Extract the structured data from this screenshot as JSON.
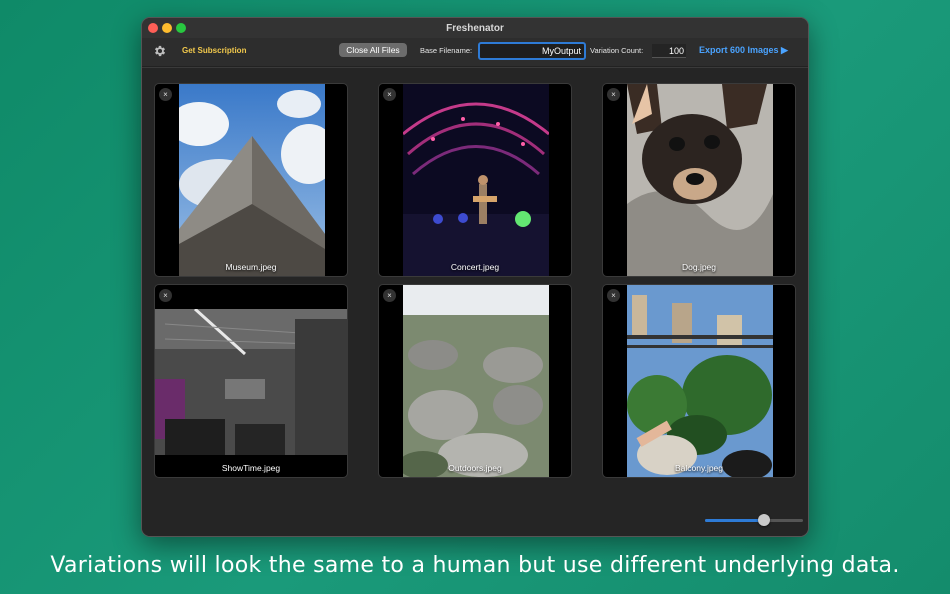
{
  "window": {
    "title": "Freshenator"
  },
  "toolbar": {
    "subscription_label": "Get Subscription",
    "close_all_label": "Close All Files",
    "base_filename_label": "Base Filename:",
    "base_filename_value": "MyOutput",
    "variation_count_label": "Variation Count:",
    "variation_count_value": "100",
    "export_label": "Export 600 Images ▶"
  },
  "files": [
    {
      "name": "Museum.jpeg"
    },
    {
      "name": "Concert.jpeg"
    },
    {
      "name": "Dog.jpeg"
    },
    {
      "name": "ShowTime.jpeg"
    },
    {
      "name": "Outdoors.jpeg"
    },
    {
      "name": "Balcony.jpeg"
    }
  ],
  "close_icon_glyph": "×",
  "zoom_slider": {
    "value": 0.6
  },
  "caption": "Variations will look the same to a human but use different underlying data.",
  "colors": {
    "background": "#0f8a68",
    "accent": "#2e7bd6",
    "subscription": "#f2c94c",
    "export": "#4aa3ff"
  }
}
